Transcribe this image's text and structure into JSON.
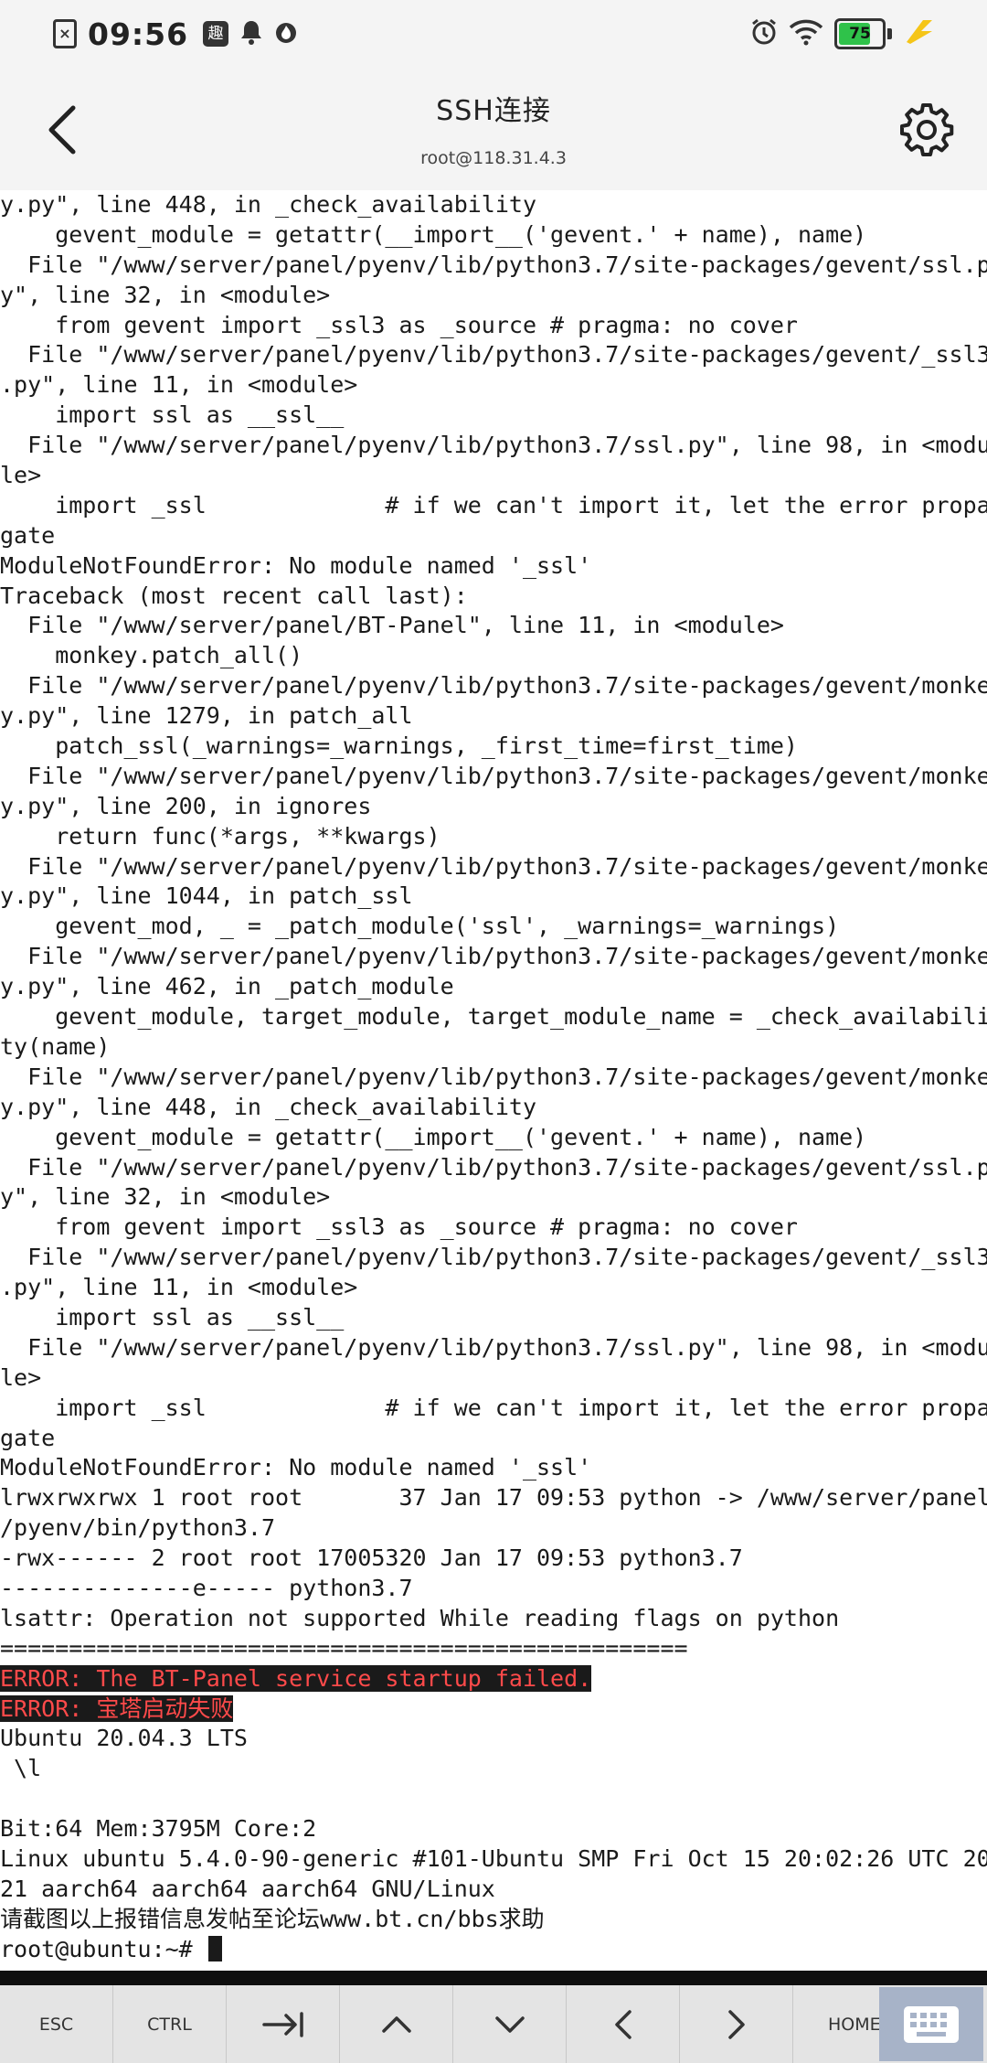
{
  "status_bar": {
    "time": "09:56",
    "battery": "75",
    "left_icons": [
      "sim-off-icon",
      "app-notification-icon",
      "bell-icon",
      "fire-icon"
    ],
    "right_icons": [
      "alarm-icon",
      "wifi-icon",
      "battery-icon",
      "charging-bolt-icon"
    ]
  },
  "header": {
    "title": "SSH连接",
    "subtitle": "root@118.31.4.3"
  },
  "terminal": {
    "lines": [
      "y.py\", line 448, in _check_availability",
      "    gevent_module = getattr(__import__('gevent.' + name), name)",
      "  File \"/www/server/panel/pyenv/lib/python3.7/site-packages/gevent/ssl.p",
      "y\", line 32, in <module>",
      "    from gevent import _ssl3 as _source # pragma: no cover",
      "  File \"/www/server/panel/pyenv/lib/python3.7/site-packages/gevent/_ssl3",
      ".py\", line 11, in <module>",
      "    import ssl as __ssl__",
      "  File \"/www/server/panel/pyenv/lib/python3.7/ssl.py\", line 98, in <modu",
      "le>",
      "    import _ssl             # if we can't import it, let the error propa",
      "gate",
      "ModuleNotFoundError: No module named '_ssl'",
      "Traceback (most recent call last):",
      "  File \"/www/server/panel/BT-Panel\", line 11, in <module>",
      "    monkey.patch_all()",
      "  File \"/www/server/panel/pyenv/lib/python3.7/site-packages/gevent/monke",
      "y.py\", line 1279, in patch_all",
      "    patch_ssl(_warnings=_warnings, _first_time=first_time)",
      "  File \"/www/server/panel/pyenv/lib/python3.7/site-packages/gevent/monke",
      "y.py\", line 200, in ignores",
      "    return func(*args, **kwargs)",
      "  File \"/www/server/panel/pyenv/lib/python3.7/site-packages/gevent/monke",
      "y.py\", line 1044, in patch_ssl",
      "    gevent_mod, _ = _patch_module('ssl', _warnings=_warnings)",
      "  File \"/www/server/panel/pyenv/lib/python3.7/site-packages/gevent/monke",
      "y.py\", line 462, in _patch_module",
      "    gevent_module, target_module, target_module_name = _check_availabili",
      "ty(name)",
      "  File \"/www/server/panel/pyenv/lib/python3.7/site-packages/gevent/monke",
      "y.py\", line 448, in _check_availability",
      "    gevent_module = getattr(__import__('gevent.' + name), name)",
      "  File \"/www/server/panel/pyenv/lib/python3.7/site-packages/gevent/ssl.p",
      "y\", line 32, in <module>",
      "    from gevent import _ssl3 as _source # pragma: no cover",
      "  File \"/www/server/panel/pyenv/lib/python3.7/site-packages/gevent/_ssl3",
      ".py\", line 11, in <module>",
      "    import ssl as __ssl__",
      "  File \"/www/server/panel/pyenv/lib/python3.7/ssl.py\", line 98, in <modu",
      "le>",
      "    import _ssl             # if we can't import it, let the error propa",
      "gate",
      "ModuleNotFoundError: No module named '_ssl'",
      "lrwxrwxrwx 1 root root       37 Jan 17 09:53 python -> /www/server/panel",
      "/pyenv/bin/python3.7",
      "-rwx------ 2 root root 17005320 Jan 17 09:53 python3.7",
      "--------------e----- python3.7",
      "lsattr: Operation not supported While reading flags on python",
      "=================================================="
    ],
    "error_lines": [
      "ERROR: The BT-Panel service startup failed.",
      "ERROR: 宝塔启动失败"
    ],
    "after_lines": [
      "Ubuntu 20.04.3 LTS",
      " \\l",
      "",
      "Bit:64 Mem:3795M Core:2",
      "Linux ubuntu 5.4.0-90-generic #101-Ubuntu SMP Fri Oct 15 20:02:26 UTC 20",
      "21 aarch64 aarch64 aarch64 GNU/Linux",
      "请截图以上报错信息发帖至论坛www.bt.cn/bbs求助"
    ],
    "prompt": "root@ubuntu:~# "
  },
  "keybar": {
    "esc": "ESC",
    "ctrl": "CTRL",
    "tab_icon": "tab-arrow-icon",
    "up_icon": "chevron-up-icon",
    "down_icon": "chevron-down-icon",
    "left_icon": "chevron-left-icon",
    "right_icon": "chevron-right-icon",
    "home": "HOME",
    "keyboard_icon": "keyboard-icon"
  },
  "colors": {
    "error_text": "#ff4a4a",
    "error_bg": "#1a1a1a",
    "battery": "#2fc24a",
    "charging": "#f5c518",
    "keyboard_button": "#a7b3c8"
  }
}
